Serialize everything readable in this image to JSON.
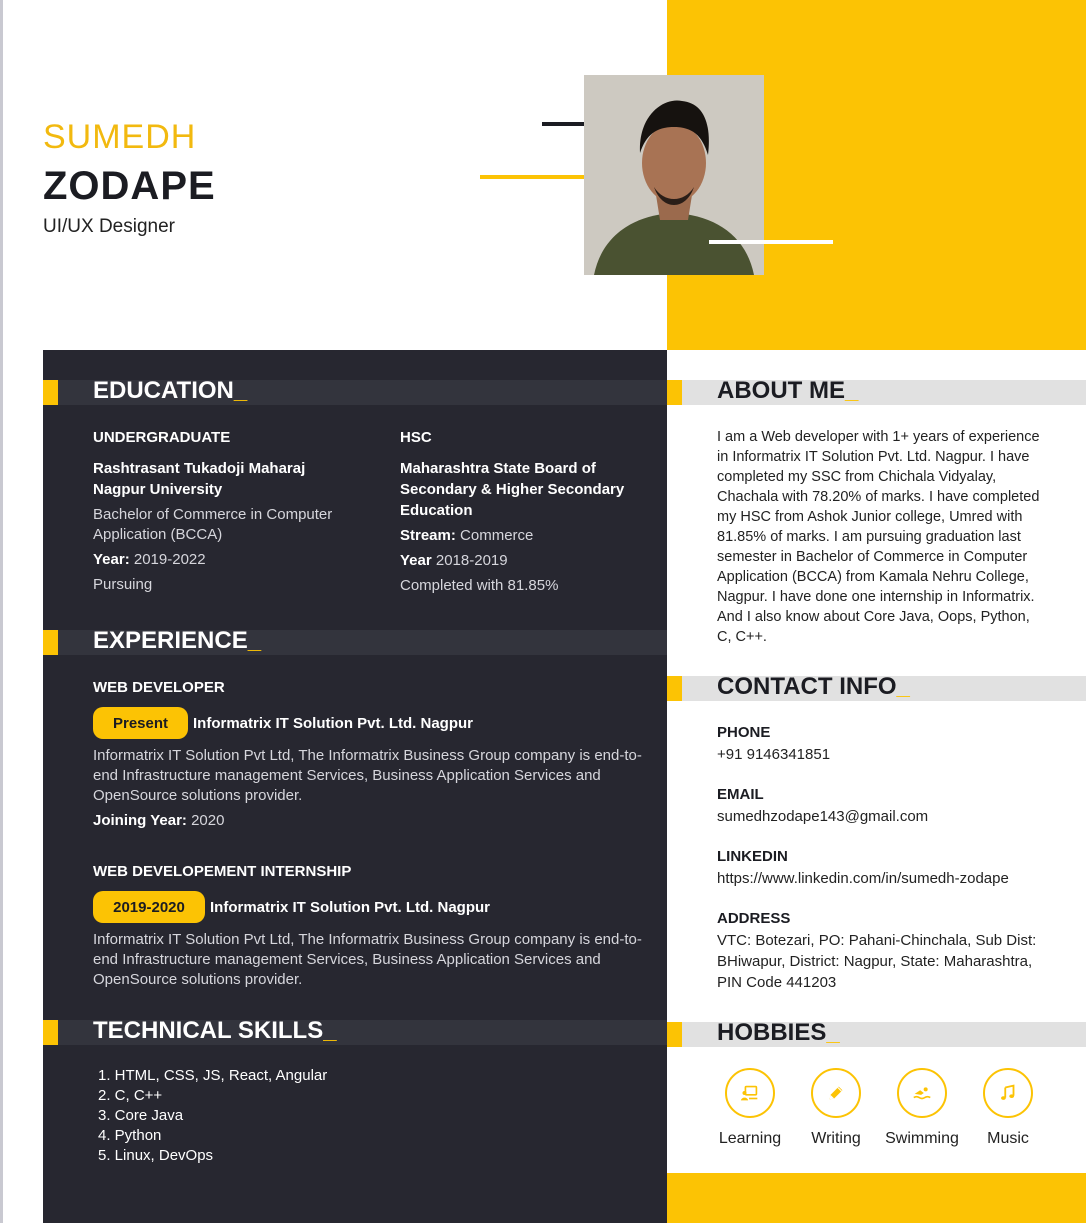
{
  "header": {
    "first_name": "SUMEDH",
    "last_name": "ZODAPE",
    "title": "UI/UX Designer"
  },
  "education": {
    "heading": "EDUCATION",
    "undergrad": {
      "level": "UNDERGRADUATE",
      "institution_line1": "Rashtrasant Tukadoji Maharaj",
      "institution_line2": "Nagpur University",
      "degree_line1": "Bachelor of Commerce in Computer",
      "degree_line2": "Application (BCCA)",
      "year_label": "Year:",
      "year_value": "2019-2022",
      "status": "Pursuing"
    },
    "hsc": {
      "level": "HSC",
      "board_line1": "Maharashtra State Board of",
      "board_line2": "Secondary & Higher Secondary",
      "board_line3": "Education",
      "stream_label": "Stream:",
      "stream_value": "Commerce",
      "year_label": "Year",
      "year_value": "2018-2019",
      "result": "Completed with 81.85%"
    }
  },
  "experience": {
    "heading": "EXPERIENCE",
    "jobs": [
      {
        "role": "WEB DEVELOPER",
        "badge": "Present",
        "company": "Informatrix IT Solution Pvt. Ltd. Nagpur",
        "desc_line1": "Informatrix IT Solution Pvt Ltd, The Informatrix Business Group company is end-to-",
        "desc_line2": "end Infrastructure management Services, Business Application Services and",
        "desc_line3": "OpenSource solutions provider.",
        "joining_label": "Joining Year:",
        "joining_value": "2020"
      },
      {
        "role": "WEB DEVELOPEMENT INTERNSHIP",
        "badge": "2019-2020",
        "company": "Informatrix IT Solution Pvt. Ltd. Nagpur",
        "desc_line1": "Informatrix IT Solution Pvt Ltd, The Informatrix Business Group company is end-to-",
        "desc_line2": "end Infrastructure management Services, Business Application Services and",
        "desc_line3": "OpenSource solutions provider."
      }
    ]
  },
  "skills": {
    "heading": "TECHNICAL SKILLS",
    "items": [
      "1. HTML, CSS, JS, React, Angular",
      "2. C, C++",
      "3. Core Java",
      "4. Python",
      "5. Linux, DevOps"
    ]
  },
  "about": {
    "heading": "ABOUT ME",
    "text": "I am a Web developer with 1+ years of experience in Informatrix IT Solution Pvt. Ltd. Nagpur. I have completed my SSC from Chichala Vidyalay, Chachala with 78.20% of marks. I have completed my HSC from Ashok Junior college, Umred with 81.85% of marks. I am pursuing graduation last semester in Bachelor of Commerce in Computer Application (BCCA) from Kamala Nehru College, Nagpur. I have done one internship in Informatrix. And I also know about Core Java, Oops, Python, C, C++."
  },
  "contact": {
    "heading": "CONTACT INFO",
    "phone_label": "PHONE",
    "phone": "+91 9146341851",
    "email_label": "EMAIL",
    "email": "sumedhzodape143@gmail.com",
    "linkedin_label": "LINKEDIN",
    "linkedin": "https://www.linkedin.com/in/sumedh-zodape",
    "address_label": "ADDRESS",
    "address": "VTC: Botezari, PO: Pahani-Chinchala, Sub Dist: BHiwapur, District: Nagpur, State: Maharashtra, PIN Code 441203"
  },
  "hobbies": {
    "heading": "HOBBIES",
    "items": [
      {
        "label": "Learning",
        "icon": "learning-icon"
      },
      {
        "label": "Writing",
        "icon": "pencil-icon"
      },
      {
        "label": "Swimming",
        "icon": "swimming-icon"
      },
      {
        "label": "Music",
        "icon": "music-note-icon"
      }
    ]
  },
  "colors": {
    "accent": "#fcc304",
    "dark_panel": "#272730",
    "name_yellow": "#f2b90f"
  }
}
